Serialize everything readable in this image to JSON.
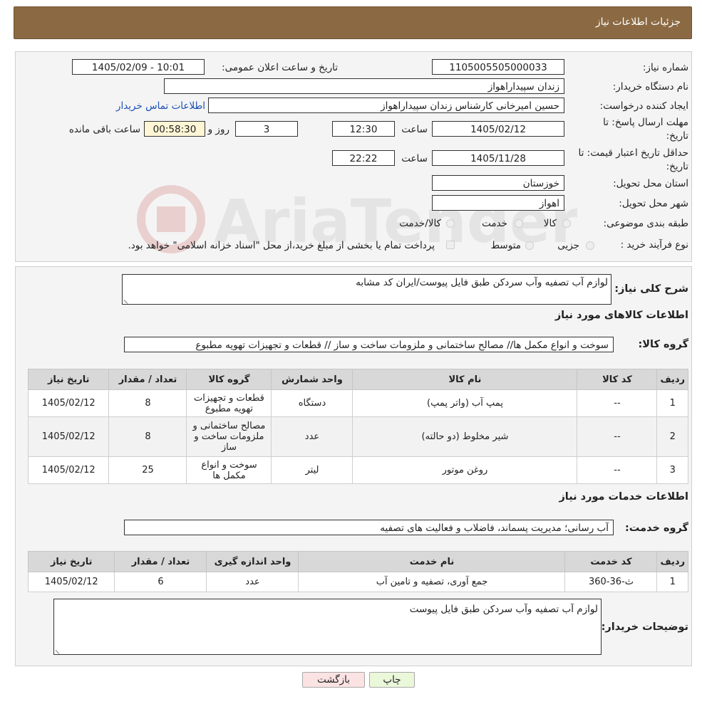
{
  "header": {
    "title": "جزئیات اطلاعات نیاز"
  },
  "form": {
    "need_number_label": "شماره نیاز:",
    "need_number": "1105005505000033",
    "announce_label": "تاریخ و ساعت اعلان عمومی:",
    "announce_value": "1405/02/09 - 10:01",
    "buyer_label": "نام دستگاه خریدار:",
    "buyer_value": "زندان سپیداراهواز",
    "creator_label": "ایجاد کننده درخواست:",
    "creator_value": "حسین امیرخانی کارشناس زندان سپیداراهواز",
    "contact_link": "اطلاعات تماس خریدار",
    "deadline_label_1": "مهلت ارسال پاسخ: تا",
    "deadline_label_2": "تاریخ:",
    "deadline_date": "1405/02/12",
    "time_label": "ساعت",
    "deadline_time": "12:30",
    "days_value": "3",
    "days_label": "روز و",
    "remaining_time": "00:58:30",
    "remaining_label": "ساعت باقی مانده",
    "validity_label_1": "حداقل تاریخ اعتبار قیمت: تا",
    "validity_label_2": "تاریخ:",
    "validity_date": "1405/11/28",
    "validity_time": "22:22",
    "province_label": "استان محل تحویل:",
    "province_value": "خوزستان",
    "city_label": "شهر محل تحویل:",
    "city_value": "اهواز",
    "category_label": "طبقه بندی موضوعی:",
    "category_options": [
      "کالا",
      "خدمت",
      "کالا/خدمت"
    ],
    "process_label": "نوع فرآیند خرید :",
    "process_options": [
      "جزیی",
      "متوسط"
    ],
    "process_note": "پرداخت تمام یا بخشی از مبلغ خرید،از محل \"اسناد خزانه اسلامی\" خواهد بود."
  },
  "summary": {
    "label": "شرح کلی نیاز:",
    "value": "لوازم آب تصفیه وآب سردکن طبق فایل پیوست/ایران کد مشابه"
  },
  "goods": {
    "section_title": "اطلاعات کالاهای مورد نیاز",
    "group_label": "گروه کالا:",
    "group_value": "سوخت و انواع مکمل ها// مصالح ساختمانی و ملزومات ساخت و ساز //  قطعات و تجهیزات تهویه مطبوع",
    "columns": [
      "ردیف",
      "کد کالا",
      "نام کالا",
      "واحد شمارش",
      "گروه کالا",
      "تعداد / مقدار",
      "تاریخ نیاز"
    ],
    "rows": [
      [
        "1",
        "--",
        "پمپ آب (واتر پمپ)",
        "دستگاه",
        "قطعات و تجهیزات تهویه مطبوع",
        "8",
        "1405/02/12"
      ],
      [
        "2",
        "--",
        "شیر مخلوط (دو حالته)",
        "عدد",
        "مصالح ساختمانی و ملزومات ساخت و ساز",
        "8",
        "1405/02/12"
      ],
      [
        "3",
        "--",
        "روغن موتور",
        "لیتر",
        "سوخت و انواع مکمل ها",
        "25",
        "1405/02/12"
      ]
    ]
  },
  "services": {
    "section_title": "اطلاعات خدمات مورد نیاز",
    "group_label": "گروه خدمت:",
    "group_value": "آب رسانی؛ مدیریت پسماند، فاضلاب و فعالیت های تصفیه",
    "columns": [
      "ردیف",
      "کد خدمت",
      "نام خدمت",
      "واحد اندازه گیری",
      "تعداد / مقدار",
      "تاریخ نیاز"
    ],
    "rows": [
      [
        "1",
        "ث-36-360",
        "جمع آوری، تصفیه و تامین آب",
        "عدد",
        "6",
        "1405/02/12"
      ]
    ]
  },
  "buyer_notes": {
    "label": "توضیحات خریدار:",
    "value": "لوازم آب تصفیه وآب سردکن طبق فایل پیوست"
  },
  "buttons": {
    "print": "چاپ",
    "back": "بازگشت"
  },
  "colors": {
    "header_bg": "#8b6a43",
    "link": "#1a4fb5",
    "print_btn": "#eaf7d9",
    "back_btn": "#fbe3e3"
  }
}
